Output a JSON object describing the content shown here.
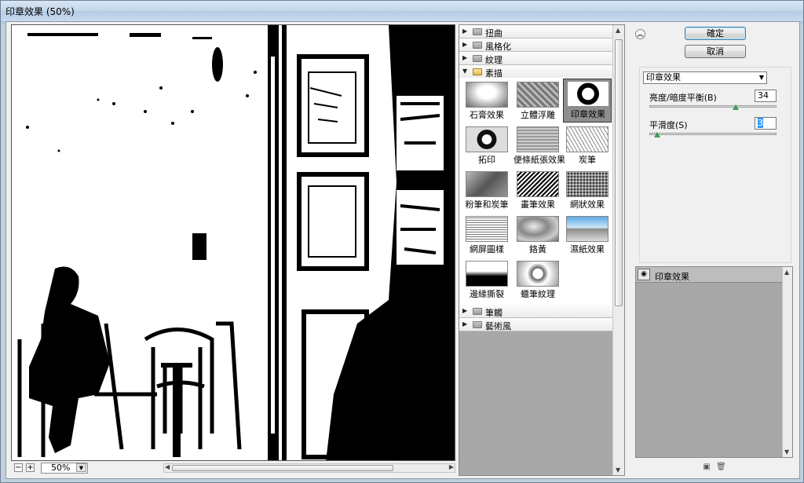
{
  "window": {
    "title": "印章效果 (50%)"
  },
  "preview": {
    "zoom": "50%",
    "zoom_out": "−",
    "zoom_in": "+"
  },
  "gallery": {
    "categories_top": [
      {
        "label": "扭曲",
        "expanded": false
      },
      {
        "label": "風格化",
        "expanded": false
      },
      {
        "label": "紋理",
        "expanded": false
      },
      {
        "label": "素描",
        "expanded": true
      }
    ],
    "filters": [
      {
        "label": "石膏效果",
        "style": "plaster"
      },
      {
        "label": "立體浮雕",
        "style": "relief"
      },
      {
        "label": "印章效果",
        "style": "stamp",
        "selected": true
      },
      {
        "label": "拓印",
        "style": "rub"
      },
      {
        "label": "便條紙張效果",
        "style": "notepaper"
      },
      {
        "label": "炭筆",
        "style": "charcoal"
      },
      {
        "label": "粉筆和炭筆",
        "style": "chalk"
      },
      {
        "label": "畫筆效果",
        "style": "graphic"
      },
      {
        "label": "網狀效果",
        "style": "reticulation"
      },
      {
        "label": "網屏圖樣",
        "style": "halftone"
      },
      {
        "label": "鉻黃",
        "style": "chrome"
      },
      {
        "label": "濕紙效果",
        "style": "water"
      },
      {
        "label": "邊緣撕裂",
        "style": "torn"
      },
      {
        "label": "蠟筆紋理",
        "style": "conte"
      }
    ],
    "categories_bottom": [
      {
        "label": "筆觸"
      },
      {
        "label": "藝術風"
      }
    ]
  },
  "dialog": {
    "ok_label": "確定",
    "cancel_label": "取消",
    "filter_select": "印章效果",
    "params": [
      {
        "label": "亮度/暗度平衡(B)",
        "value": "34",
        "level": 0.68
      },
      {
        "label": "平滑度(S)",
        "value": "3",
        "level": 0.06
      }
    ]
  },
  "layers": {
    "items": [
      {
        "name": "印章效果"
      }
    ]
  },
  "colors": {
    "accent": "#3399ff",
    "knob": "#3b9b58"
  }
}
